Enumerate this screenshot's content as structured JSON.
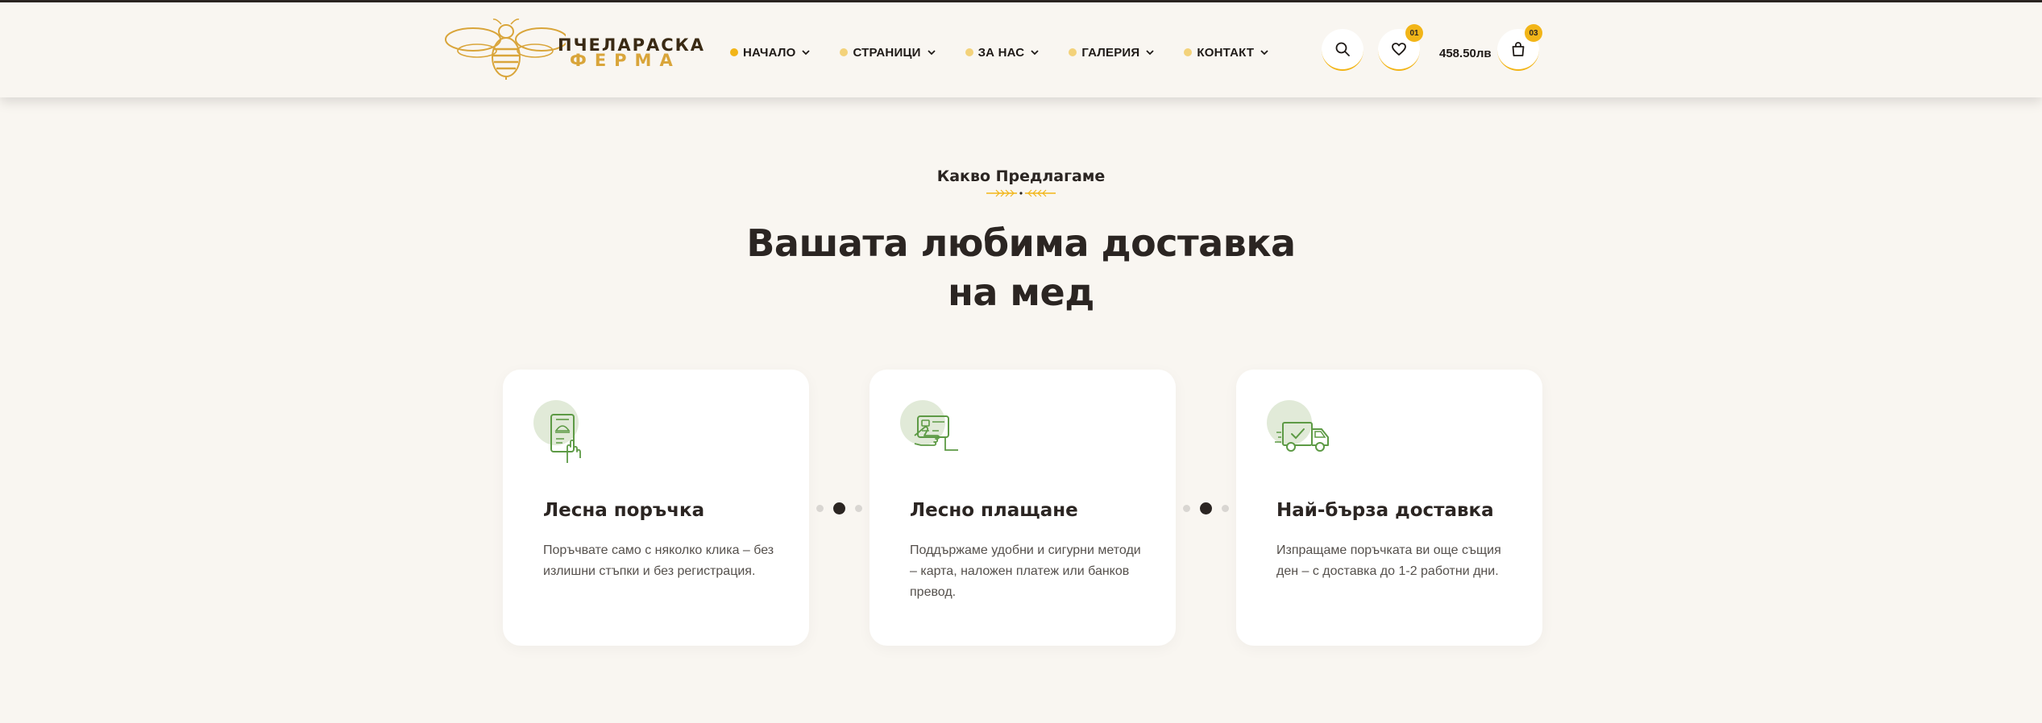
{
  "logo": {
    "line1": "ПЧЕЛАРАСКА",
    "line2": "ФЕРМА"
  },
  "nav": {
    "items": [
      {
        "label": "НАЧАЛО",
        "active": true
      },
      {
        "label": "СТРАНИЦИ",
        "active": false
      },
      {
        "label": "ЗА НАС",
        "active": false
      },
      {
        "label": "ГАЛЕРИЯ",
        "active": false
      },
      {
        "label": "КОНТАКТ",
        "active": false
      }
    ]
  },
  "header_actions": {
    "search_icon": "search-icon",
    "wishlist_icon": "heart-icon",
    "wishlist_count": "01",
    "cart_total": "458.50лв",
    "cart_icon": "shopping-bag-icon",
    "cart_count": "03"
  },
  "section": {
    "subtitle": "Какво Предлагаме",
    "title": "Вашата любима доставка на мед"
  },
  "features": [
    {
      "icon": "mobile-order-icon",
      "title": "Лесна поръчка",
      "text": "Поръчвате само с няколко клика – без излишни стъпки и без регистрация."
    },
    {
      "icon": "card-payment-icon",
      "title": "Лесно плащане",
      "text": "Поддържаме удобни и сигурни методи – карта, наложен платеж или банков превод."
    },
    {
      "icon": "delivery-truck-icon",
      "title": "Най-бърза доставка",
      "text": "Изпращаме поръчката ви още същия ден – с доставка до 1-2 работни дни."
    }
  ],
  "colors": {
    "accent": "#f2b518",
    "background": "#f9f6f1",
    "text": "#2b2522",
    "icon_green": "#5d9a45",
    "icon_blob": "#e1ead8"
  }
}
